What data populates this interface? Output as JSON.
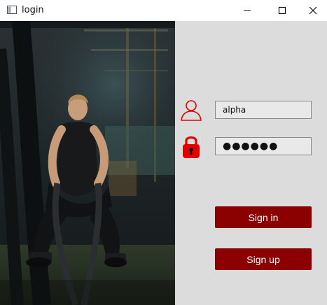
{
  "window": {
    "title": "login",
    "app_icon": "window-icon",
    "controls": [
      "minimize-icon",
      "maximize-icon",
      "close-icon"
    ]
  },
  "photo": {
    "description_icon": "fitness-photo"
  },
  "form": {
    "username_value": "alpha",
    "password_value": "●●●●●●",
    "user_icon": "user-icon",
    "lock_icon": "lock-icon",
    "signin_label": "Sign in",
    "signup_label": "Sign up"
  },
  "colors": {
    "accent": "#8b0000",
    "icon_red": "#e00000",
    "panel_bg": "#dcdcdc"
  }
}
